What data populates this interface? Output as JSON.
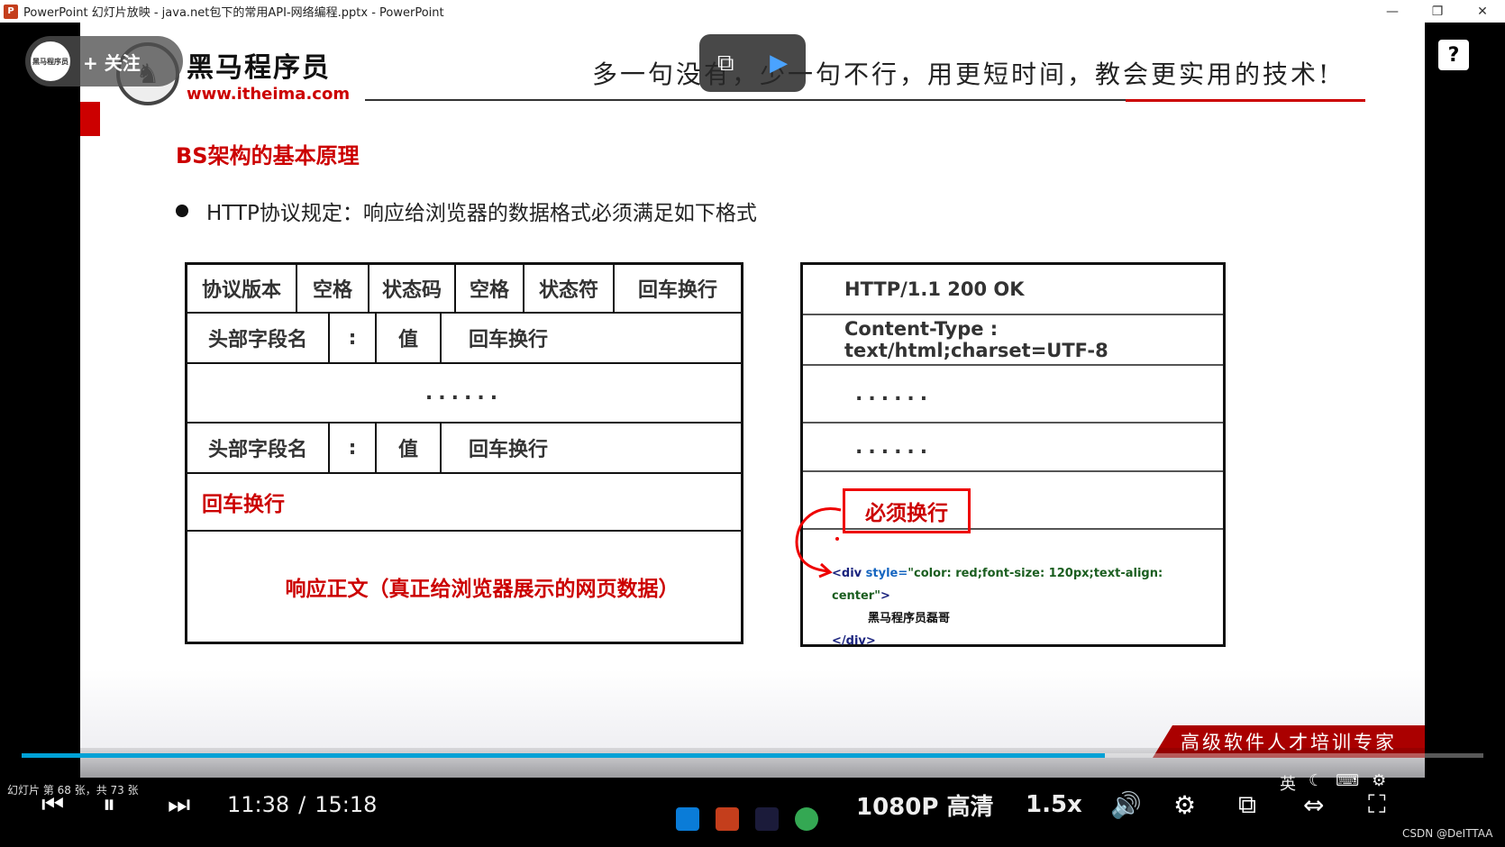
{
  "window": {
    "title": "PowerPoint 幻灯片放映 - java.net包下的常用API-网络编程.pptx - PowerPoint",
    "minimize": "—",
    "restore": "❐",
    "close": "✕"
  },
  "slide": {
    "logo_name": "黑马程序员",
    "logo_url": "www.itheima.com",
    "slogan": "多一句没有，少一句不行，用更短时间，教会更实用的技术!",
    "heading": "BS架构的基本原理",
    "bullet": "HTTP协议规定：响应给浏览器的数据格式必须满足如下格式",
    "left_table": {
      "status_line": [
        "协议版本",
        "空格",
        "状态码",
        "空格",
        "状态符",
        "回车换行"
      ],
      "header_row": [
        "头部字段名",
        ":",
        "值",
        "回车换行"
      ],
      "dots": "......",
      "blank_line": "回车换行",
      "body": "响应正文（真正给浏览器展示的网页数据）"
    },
    "right_table": {
      "status_line": "HTTP/1.1   200   OK",
      "content_type": "Content-Type : text/html;charset=UTF-8",
      "dots1": "......",
      "dots2": "......",
      "must_newline": "必须换行",
      "code_open_tag": "<div",
      "code_attr": "style=",
      "code_value": "\"color: red;font-size: 120px;text-align: center\"",
      "code_close_bracket": ">",
      "code_text": "黑马程序员磊哥",
      "code_close_tag": "</div>"
    },
    "banner": "高级软件人才培训专家"
  },
  "overlay": {
    "follow_label": "+ 关注",
    "follow_avatar_text": "黑马程序员",
    "help": "?"
  },
  "player": {
    "progress": 0.741,
    "current_time": "11:38",
    "separator": "/",
    "total_time": "15:18",
    "quality": "1080P 高清",
    "speed": "1.5x",
    "slide_status": "幻灯片 第 68 张，共 73 张",
    "ime_label": "英"
  },
  "watermark": "CSDN @DeITTAA",
  "colors": {
    "accent_red": "#c00000",
    "progress_blue": "#00a1d6"
  }
}
